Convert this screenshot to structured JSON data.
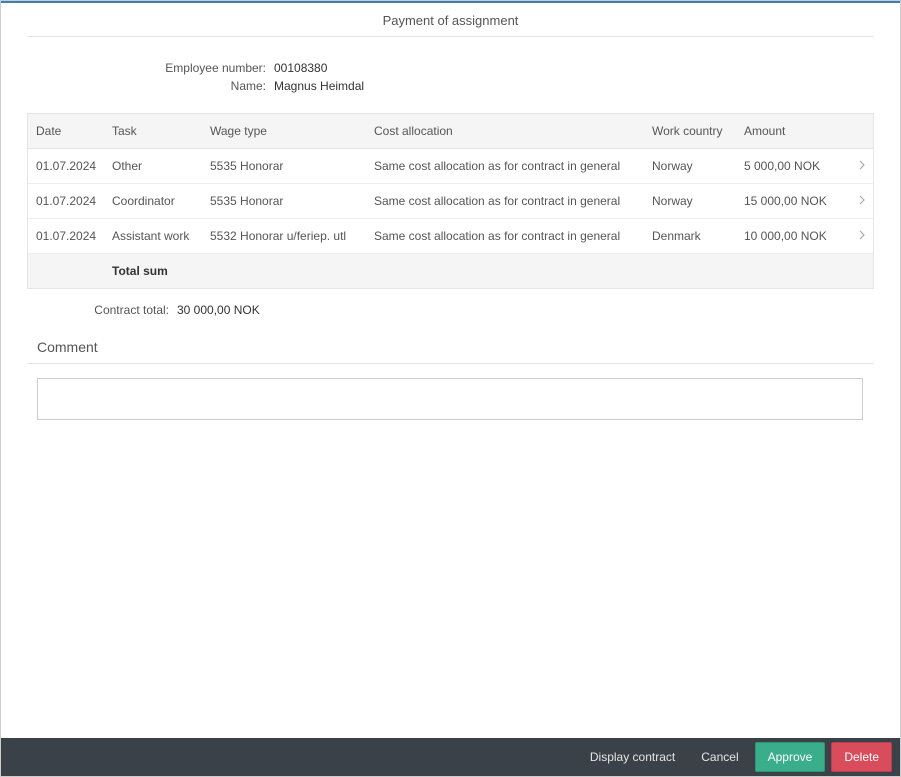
{
  "page_title": "Payment of assignment",
  "employee": {
    "number_label": "Employee number:",
    "number_value": "00108380",
    "name_label": "Name:",
    "name_value": "Magnus Heimdal"
  },
  "table": {
    "headers": {
      "date": "Date",
      "task": "Task",
      "wage": "Wage type",
      "cost": "Cost allocation",
      "country": "Work country",
      "amount": "Amount"
    },
    "rows": [
      {
        "date": "01.07.2024",
        "task": "Other",
        "wage": "5535 Honorar",
        "cost": "Same cost allocation as for contract in general",
        "country": "Norway",
        "amount": "5 000,00 NOK"
      },
      {
        "date": "01.07.2024",
        "task": "Coordinator",
        "wage": "5535 Honorar",
        "cost": "Same cost allocation as for contract in general",
        "country": "Norway",
        "amount": "15 000,00 NOK"
      },
      {
        "date": "01.07.2024",
        "task": "Assistant work",
        "wage": "5532 Honorar u/feriep. utl",
        "cost": "Same cost allocation as for contract in general",
        "country": "Denmark",
        "amount": "10 000,00 NOK"
      }
    ],
    "total_sum_label": "Total sum"
  },
  "contract_total": {
    "label": "Contract total:",
    "value": "30 000,00 NOK"
  },
  "comment": {
    "heading": "Comment",
    "value": ""
  },
  "footer": {
    "display_contract": "Display contract",
    "cancel": "Cancel",
    "approve": "Approve",
    "delete": "Delete"
  }
}
